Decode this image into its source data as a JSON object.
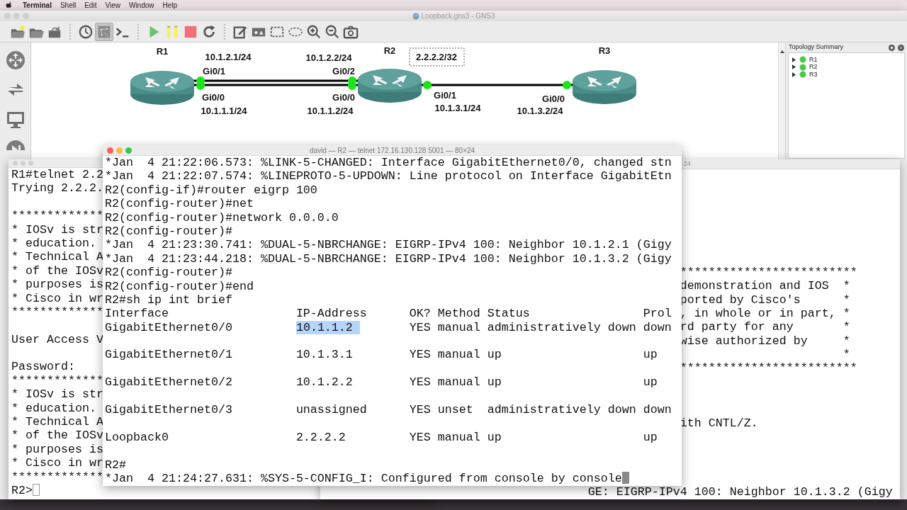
{
  "menubar": {
    "app": "Terminal",
    "items": [
      "Shell",
      "Edit",
      "View",
      "Window",
      "Help"
    ]
  },
  "gns3": {
    "title": "Loopback.gns3 - GNS3",
    "toolbar": [
      {
        "kind": "new-project",
        "selected": false
      },
      {
        "kind": "open",
        "selected": false
      },
      {
        "kind": "save",
        "selected": false
      },
      {
        "kind": "clock",
        "selected": false
      },
      {
        "kind": "labels",
        "selected": true
      },
      {
        "kind": "console",
        "selected": false
      },
      {
        "kind": "start",
        "selected": false
      },
      {
        "kind": "suspend",
        "selected": false
      },
      {
        "kind": "stop",
        "selected": false
      },
      {
        "kind": "reload",
        "selected": false
      },
      {
        "kind": "note",
        "selected": false
      },
      {
        "kind": "image",
        "selected": false
      },
      {
        "kind": "rectangle",
        "selected": false
      },
      {
        "kind": "ellipse",
        "selected": false
      },
      {
        "kind": "zoom-in",
        "selected": false
      },
      {
        "kind": "zoom-out",
        "selected": false
      },
      {
        "kind": "screenshot",
        "selected": false
      }
    ],
    "dock": [
      {
        "kind": "router"
      },
      {
        "kind": "switch"
      },
      {
        "kind": "host"
      },
      {
        "kind": "all"
      }
    ],
    "topology": {
      "nodes": [
        {
          "label": "R1"
        },
        {
          "label": "R2"
        },
        {
          "label": "R3"
        }
      ],
      "links": [
        {
          "up": true,
          "ends": [
            {
              "port": "Gi0/1",
              "address": "10.1.2.1/24"
            },
            {
              "port": "Gi0/2",
              "address": "10.1.2.2/24"
            }
          ]
        },
        {
          "up": true,
          "ends": [
            {
              "port": "Gi0/0",
              "address": "10.1.1.1/24"
            },
            {
              "port": "Gi0/0",
              "address": "10.1.1.2/24"
            }
          ]
        },
        {
          "up": true,
          "ends": [
            {
              "port": "Gi0/1",
              "address": "10.1.3.1/24"
            },
            {
              "port": "Gi0/0",
              "address": "10.1.3.2/24"
            }
          ]
        }
      ],
      "note": "2.2.2.2/32"
    },
    "summary": {
      "title": "Topology Summary",
      "items": [
        {
          "label": "R1",
          "expanded": false,
          "running": true
        },
        {
          "label": "R2",
          "expanded": false,
          "running": true
        },
        {
          "label": "R3",
          "expanded": false,
          "running": true
        }
      ]
    }
  },
  "terminals": [
    {
      "active": false,
      "lines": [
        {
          "text": "R1#telnet 2.2"
        },
        {
          "text": "Trying 2.2.2."
        },
        {
          "text": "*************"
        },
        {
          "text": "* IOSv is str"
        },
        {
          "text": "* education."
        },
        {
          "text": "* Technical A"
        },
        {
          "text": "* of the IOSv"
        },
        {
          "text": "* purposes is"
        },
        {
          "text": "* Cisco in wr"
        },
        {
          "text": "*************"
        },
        {
          "text": "User Access V"
        },
        {
          "text": "Password:"
        },
        {
          "text": "*************"
        },
        {
          "text": "* IOSv is str"
        },
        {
          "text": "* education."
        },
        {
          "text": "* Technical A"
        },
        {
          "text": "* of the IOSv"
        },
        {
          "text": "* purposes is"
        },
        {
          "text": "* Cisco in wr"
        },
        {
          "text": "*************"
        },
        {
          "text": "R2>",
          "cursor": true
        }
      ]
    },
    {
      "title": "24",
      "lines": [
        {
          "text": "*************************"
        },
        {
          "text": "demonstration and IOS  *"
        },
        {
          "text": "ported by Cisco's      *"
        },
        {
          "text": ", in whole or in part, *"
        },
        {
          "text": "rd party for any       *"
        },
        {
          "text": "wise authorized by     *"
        },
        {
          "text": "*"
        },
        {
          "text": "*************************"
        },
        {
          "text": "ith CNTL/Z."
        },
        {
          "text": "GE: EIGRP-IPv4 100: Neighbor 10.1.3.2 (Gigy"
        }
      ]
    },
    {
      "title": "david — R2 — telnet 172.16.130.128 5001 — 80×24",
      "active": true,
      "lines": [
        {
          "text": "*Jan  4 21:22:06.573: %LINK-5-CHANGED: Interface GigabitEthernet0/0, changed stn"
        },
        {
          "text": "*Jan  4 21:22:07.574: %LINEPROTO-5-UPDOWN: Line protocol on Interface GigabitEtn"
        },
        {
          "text": "R2(config-if)#router eigrp 100"
        },
        {
          "text": "R2(config-router)#net"
        },
        {
          "text": "R2(config-router)#network 0.0.0.0"
        },
        {
          "text": "R2(config-router)#"
        },
        {
          "text": "*Jan  4 21:23:30.741: %DUAL-5-NBRCHANGE: EIGRP-IPv4 100: Neighbor 10.1.2.1 (Gigy"
        },
        {
          "text": "*Jan  4 21:23:44.218: %DUAL-5-NBRCHANGE: EIGRP-IPv4 100: Neighbor 10.1.3.2 (Gigy"
        },
        {
          "text": "R2(config-router)#"
        },
        {
          "text": "R2(config-router)#end"
        },
        {
          "text": "R2#sh ip int brief"
        },
        {
          "text": "Interface                  IP-Address      OK? Method Status                Prol"
        },
        {
          "segments": [
            {
              "text": "GigabitEthernet0/0         ",
              "selected": false
            },
            {
              "text": "10.1.1.2 ",
              "selected": true
            },
            {
              "text": "       YES manual administratively down down",
              "selected": false
            }
          ]
        },
        {
          "text": "GigabitEthernet0/1         10.1.3.1        YES manual up                    up"
        },
        {
          "text": "GigabitEthernet0/2         10.1.2.2        YES manual up                    up"
        },
        {
          "text": "GigabitEthernet0/3         unassigned      YES unset  administratively down down"
        },
        {
          "text": "Loopback0                  2.2.2.2         YES manual up                    up"
        },
        {
          "text": "R2#"
        },
        {
          "text": "*Jan  4 21:24:27.631: %SYS-5-CONFIG_I: Configured from console by console",
          "cursor": true
        }
      ]
    }
  ]
}
